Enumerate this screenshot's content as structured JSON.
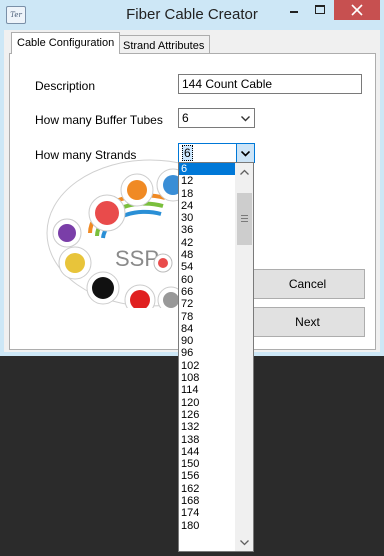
{
  "window": {
    "title": "Fiber Cable Creator",
    "icon_text": "Ter"
  },
  "tabs": [
    {
      "label": "Cable Configuration",
      "active": true
    },
    {
      "label": "Strand Attributes",
      "active": false
    }
  ],
  "form": {
    "description_label": "Description",
    "description_value": "144 Count Cable",
    "buffer_tubes_label": "How many Buffer Tubes",
    "buffer_tubes_value": "6",
    "strands_label": "How many Strands",
    "strands_value": "6"
  },
  "buttons": {
    "cancel": "Cancel",
    "next": "Next"
  },
  "logo_text": "SSP",
  "strand_options": [
    "6",
    "12",
    "18",
    "24",
    "30",
    "36",
    "42",
    "48",
    "54",
    "60",
    "66",
    "72",
    "78",
    "84",
    "90",
    "96",
    "102",
    "108",
    "114",
    "120",
    "126",
    "132",
    "138",
    "144",
    "150",
    "156",
    "162",
    "168",
    "174",
    "180"
  ],
  "selected_strand_index": 0,
  "colors": {
    "titlebar": "#cde7f6",
    "close_button": "#c75050",
    "selection": "#0078d7"
  }
}
